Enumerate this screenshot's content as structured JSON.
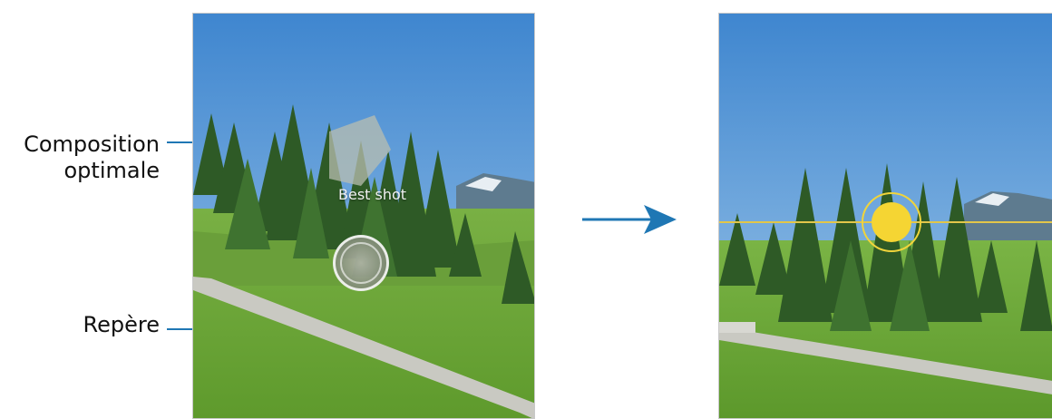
{
  "callouts": {
    "composition_line1": "Composition",
    "composition_line2": "optimale",
    "guide": "Repère"
  },
  "left_screen": {
    "overlay_text": "Best shot"
  },
  "colors": {
    "callout_line": "#1f77b4",
    "accent_yellow": "#f5d533",
    "arrow": "#1f77b4"
  },
  "icons": {
    "transition": "right-arrow-icon",
    "shutter": "shutter-button-icon",
    "guide": "guide-ring-icon"
  }
}
